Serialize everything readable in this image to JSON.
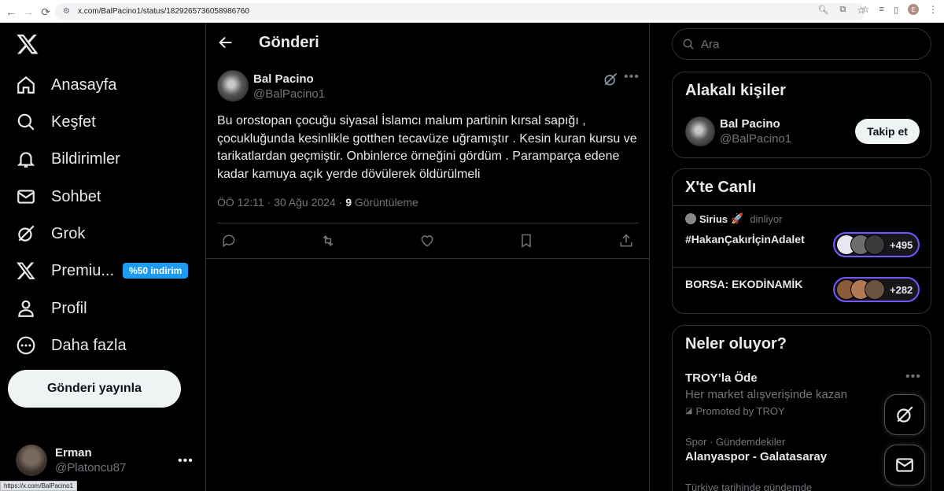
{
  "browser": {
    "url": "x.com/BalPacino1/status/1829265736058986760",
    "profile_initial": "E",
    "status_url": "https://x.com/BalPacino1"
  },
  "nav": {
    "items": [
      {
        "label": "Anasayfa",
        "icon": "home-icon"
      },
      {
        "label": "Keşfet",
        "icon": "search-icon"
      },
      {
        "label": "Bildirimler",
        "icon": "bell-icon"
      },
      {
        "label": "Sohbet",
        "icon": "mail-icon"
      },
      {
        "label": "Grok",
        "icon": "grok-icon"
      },
      {
        "label": "Premiu...",
        "icon": "x-premium-icon"
      },
      {
        "label": "Profil",
        "icon": "person-icon"
      },
      {
        "label": "Daha fazla",
        "icon": "more-circle-icon"
      }
    ],
    "premium_badge": "%50 indirim",
    "post_button": "Gönderi yayınla",
    "account": {
      "name": "Erman",
      "handle": "@Platoncu87"
    }
  },
  "main": {
    "title": "Gönderi",
    "tweet": {
      "name": "Bal Pacino",
      "handle": "@BalPacino1",
      "text": "Bu orostopan çocuğu siyasal İslamcı malum partinin kırsal sapığı , çocukluğunda kesinlikle gotthen tecavüze uğramıştır . Kesin kuran kursu ve tarikatlardan geçmiştir. Onbinlerce örneğini gördüm . Paramparça edene kadar kamuya açık yerde dövülerek öldürülmeli",
      "time": "ÖÖ 12:11 · 30 Ağu 2024 · ",
      "views": "9",
      "views_label": " Görüntüleme"
    }
  },
  "right": {
    "search_placeholder": "Ara",
    "related": {
      "title": "Alakalı kişiler",
      "name": "Bal Pacino",
      "handle": "@BalPacino1",
      "follow": "Takip et"
    },
    "live": {
      "title": "X'te Canlı",
      "host": "Sirius",
      "host_emoji": "🚀",
      "host_status": "dinliyor",
      "spaces": [
        {
          "topic": "#HakanÇakırİçinAdalet",
          "count": "+495"
        },
        {
          "topic": "BORSA: EKODİNAMİK",
          "count": "+282"
        }
      ]
    },
    "trends": {
      "title": "Neler oluyor?",
      "items": [
        {
          "title": "TROY’la Öde",
          "sub": "Her market alışverişinde kazan",
          "promo": "Promoted by TROY"
        },
        {
          "meta": "Spor · Gündemdekiler",
          "title": "Alanyaspor - Galatasaray"
        },
        {
          "meta": "Türkiye tarihinde gündemde"
        }
      ]
    }
  },
  "colors": {
    "accent": "#1d9bf0",
    "live": "#7856ff",
    "bg": "#000000",
    "border": "#2f3336"
  }
}
